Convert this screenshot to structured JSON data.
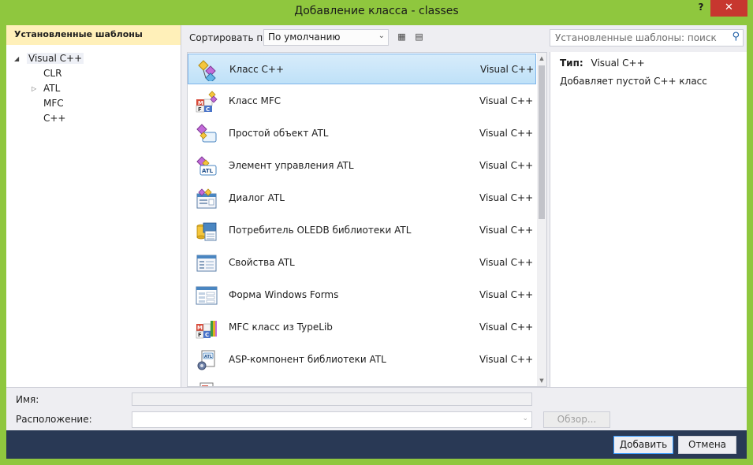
{
  "window": {
    "title": "Добавление класса - classes",
    "help_label": "?",
    "close_label": "✕"
  },
  "left_panel": {
    "header": "Установленные шаблоны",
    "tree": {
      "root": "Visual C++",
      "children": [
        "CLR",
        "ATL",
        "MFC",
        "C++"
      ]
    }
  },
  "toolbar": {
    "sort_label": "Сортировать по:",
    "sort_value": "По умолчанию",
    "search_placeholder": "Установленные шаблоны: поиск"
  },
  "templates": [
    {
      "name": "Класс C++",
      "lang": "Visual C++",
      "icon": "cpp-class-icon",
      "selected": true
    },
    {
      "name": "Класс MFC",
      "lang": "Visual C++",
      "icon": "mfc-class-icon"
    },
    {
      "name": "Простой объект ATL",
      "lang": "Visual C++",
      "icon": "atl-simple-object-icon"
    },
    {
      "name": "Элемент управления ATL",
      "lang": "Visual C++",
      "icon": "atl-control-icon"
    },
    {
      "name": "Диалог ATL",
      "lang": "Visual C++",
      "icon": "atl-dialog-icon"
    },
    {
      "name": "Потребитель OLEDB библиотеки ATL",
      "lang": "Visual C++",
      "icon": "oledb-consumer-icon"
    },
    {
      "name": "Свойства ATL",
      "lang": "Visual C++",
      "icon": "atl-properties-icon"
    },
    {
      "name": "Форма Windows Forms",
      "lang": "Visual C++",
      "icon": "windows-form-icon"
    },
    {
      "name": "MFC класс из TypeLib",
      "lang": "Visual C++",
      "icon": "mfc-typelib-icon"
    },
    {
      "name": "ASP-компонент библиотеки ATL",
      "lang": "Visual C++",
      "icon": "asp-component-icon"
    }
  ],
  "detail": {
    "type_label": "Тип:",
    "type_value": "Visual C++",
    "description": "Добавляет пустой C++ класс"
  },
  "form": {
    "name_label": "Имя:",
    "name_value": "",
    "location_label": "Расположение:",
    "location_value": "",
    "browse_label": "Обзор..."
  },
  "buttons": {
    "add": "Добавить",
    "cancel": "Отмена"
  },
  "colors": {
    "titlebar": "#8fc73e",
    "close": "#c7372f",
    "selection": "#bfe1f8",
    "tree_header": "#fff0b9",
    "button_bar": "#293955"
  }
}
